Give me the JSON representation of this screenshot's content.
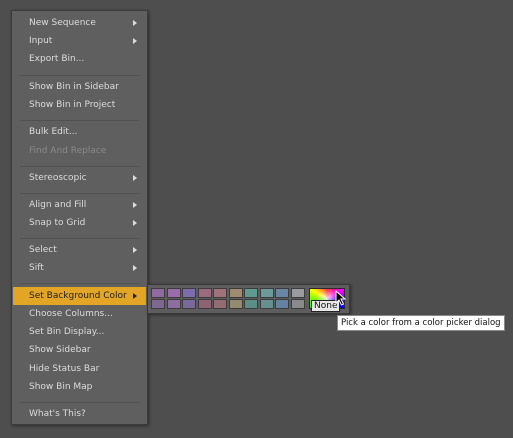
{
  "menu": {
    "items": [
      {
        "label": "New Sequence",
        "submenu": true
      },
      {
        "label": "Input",
        "submenu": true
      },
      {
        "label": "Export Bin..."
      },
      {
        "label": "Show Bin in Sidebar"
      },
      {
        "label": "Show Bin in Project"
      },
      {
        "label": "Bulk Edit..."
      },
      {
        "label": "Find And Replace",
        "disabled": true
      },
      {
        "label": "Stereoscopic",
        "submenu": true
      },
      {
        "label": "Align and Fill",
        "submenu": true
      },
      {
        "label": "Snap to Grid",
        "submenu": true
      },
      {
        "label": "Select",
        "submenu": true
      },
      {
        "label": "Sift",
        "submenu": true
      },
      {
        "label": "Set Background Color",
        "submenu": true,
        "highlighted": true
      },
      {
        "label": "Choose Columns..."
      },
      {
        "label": "Set Bin Display..."
      },
      {
        "label": "Show Sidebar"
      },
      {
        "label": "Hide Status Bar"
      },
      {
        "label": "Show Bin Map"
      },
      {
        "label": "What's This?"
      }
    ]
  },
  "color_submenu": {
    "swatches_top": [
      "#8e6aa0",
      "#9a6cac",
      "#7d6cae",
      "#9b6a7c",
      "#a2727a",
      "#a08a6e",
      "#5e9a8e",
      "#6c9a9a",
      "#6a86a6",
      "#9c9ca0"
    ],
    "swatches_bottom": [
      "#7e6892",
      "#8e6ea0",
      "#7a6a9c",
      "#8e6474",
      "#946c70",
      "#948a6e",
      "#5a8e86",
      "#669090",
      "#6682a2",
      "#8a8a8c"
    ],
    "none_label": "None",
    "picker_icon": "color-wheel-icon"
  },
  "tooltip": {
    "text": "Pick a color from a color picker dialog"
  },
  "colors": {
    "background": "#4e4e4e",
    "menu_bg": "#5f5f5f",
    "highlight": "#e3a526"
  }
}
